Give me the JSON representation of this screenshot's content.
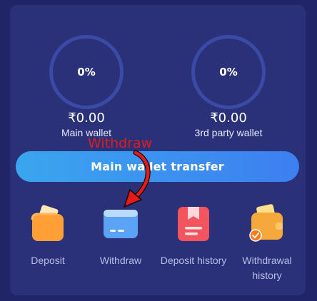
{
  "wallets": {
    "main": {
      "percent": "0%",
      "amount": "₹0.00",
      "label": "Main wallet"
    },
    "third_party": {
      "percent": "0%",
      "amount": "₹0.00",
      "label": "3rd party wallet"
    }
  },
  "transfer_button": {
    "label": "Main wallet transfer"
  },
  "annotation": {
    "text": "Withdraw"
  },
  "actions": [
    {
      "label": "Deposit",
      "icon": "wallet-icon"
    },
    {
      "label": "Withdraw",
      "icon": "card-icon"
    },
    {
      "label": "Deposit history",
      "icon": "bookmark-doc-icon"
    },
    {
      "label": "Withdrawal history",
      "icon": "wallet-check-icon"
    }
  ],
  "colors": {
    "background": "#1f2566",
    "panel": "#2a3178",
    "ring": "#3a4aa6",
    "button_start": "#3aa6ef",
    "button_end": "#3d7ff0",
    "annotation": "#e21b1b",
    "deposit_icon": "#ff9f36",
    "withdraw_icon": "#5aa3f5",
    "deposit_history_icon": "#f4545e",
    "withdrawal_history_icon": "#f7a83a"
  }
}
